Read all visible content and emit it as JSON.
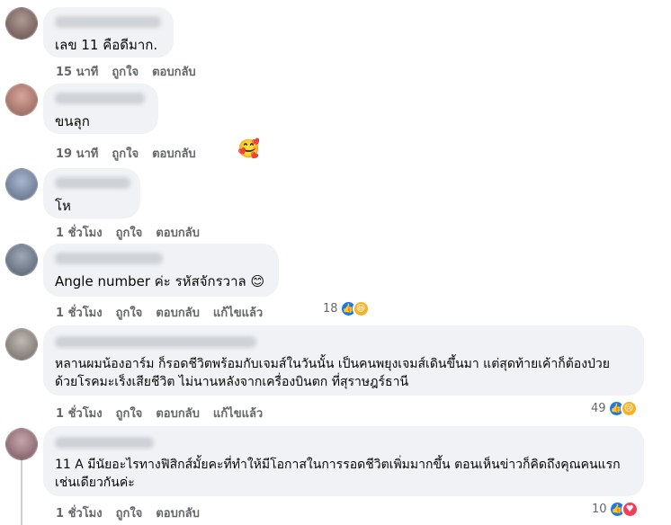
{
  "comments": [
    {
      "text": "เลข 11 คือดีมาก.",
      "time": "15 นาที",
      "like": "ถูกใจ",
      "reply": "ตอบกลับ",
      "avatar_color": "#8a6f6a"
    },
    {
      "text": "ขนลุก",
      "time": "19 นาที",
      "like": "ถูกใจ",
      "reply": "ตอบกลับ",
      "sticker": "🥰",
      "avatar_color": "#b07a6c"
    },
    {
      "text": "โห",
      "time": "1 ชั่วโมง",
      "like": "ถูกใจ",
      "reply": "ตอบกลับ",
      "avatar_color": "#7d8fa8"
    },
    {
      "text": "Angle number ค่ะ รหัสจักรวาล 😊",
      "time": "1 ชั่วโมง",
      "like": "ถูกใจ",
      "reply": "ตอบกลับ",
      "edited": "แก้ไขแล้ว",
      "reaction_count": "18",
      "reactions": [
        "like-icon",
        "haha-icon"
      ],
      "avatar_color": "#6e7b8f"
    },
    {
      "text": "หลานผมน้องอาร์ม ก็รอดชีวิตพร้อมกับเจมส์ในวันนั้น เป็นคนพยุงเจมส์เดินขึ้นมา แต่สุดท้ายเค้าก็ต้องป่วยด้วยโรคมะเร็งเสียชีวิต ไม่นานหลังจากเครื่องบินตก ที่สุราษฎร์ธานี",
      "time": "1 ชั่วโมง",
      "like": "ถูกใจ",
      "reply": "ตอบกลับ",
      "edited": "แก้ไขแล้ว",
      "reaction_count": "49",
      "reactions": [
        "like-icon",
        "sad-icon"
      ],
      "avatar_color": "#8f8a86"
    },
    {
      "text": "11 A มีนัยอะไรทางฟิสิกส์มั้ยคะที่ทำให้มีโอกาสในการรอดชีวิตเพิ่มมากขึ้น ตอนเห็นข่าวก็คิดถึงคุณคนแรกเช่นเดียวกันค่ะ",
      "time": "1 ชั่วโมง",
      "like": "ถูกใจ",
      "reply": "ตอบกลับ",
      "reaction_count": "10",
      "reactions": [
        "like-icon",
        "love-icon"
      ],
      "avatar_color": "#9a7f86"
    }
  ],
  "colors": {
    "bubble": "#f0f2f5",
    "meta": "#65676b",
    "like": "#1877f2",
    "love": "#f33e58",
    "haha": "#f7b125"
  }
}
